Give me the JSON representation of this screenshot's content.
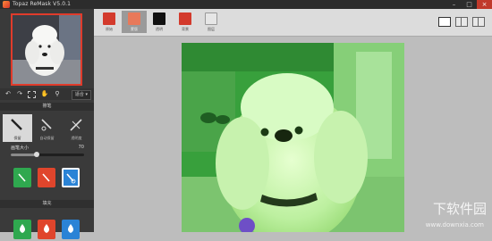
{
  "window": {
    "title": "Topaz ReMask V5.0.1"
  },
  "toolbar": {
    "zoom_label": "适合"
  },
  "panel": {
    "brush_section": "擦笔",
    "brushes": [
      {
        "label": "保留"
      },
      {
        "label": "自动保留"
      },
      {
        "label": "透明度"
      }
    ],
    "brush_size_label": "画笔大小",
    "brush_size_value": "70",
    "brush_size_fraction": 0.35,
    "fill_section": "填充"
  },
  "tabs": [
    {
      "label": "原始",
      "color": "#d33a2c"
    },
    {
      "label": "蒙版",
      "color": "#e8795a"
    },
    {
      "label": "透明",
      "color": "#111111"
    },
    {
      "label": "背景",
      "color": "#d33a2c"
    },
    {
      "label": "图层",
      "color": "#e6e6e6"
    }
  ],
  "colors": {
    "keep": "#2fa84f",
    "drop": "#e0452c",
    "compute": "#2a83d6",
    "accent": "#e03b2b"
  },
  "watermark": {
    "cn": "下软件园",
    "url": "www.downxia.com"
  }
}
